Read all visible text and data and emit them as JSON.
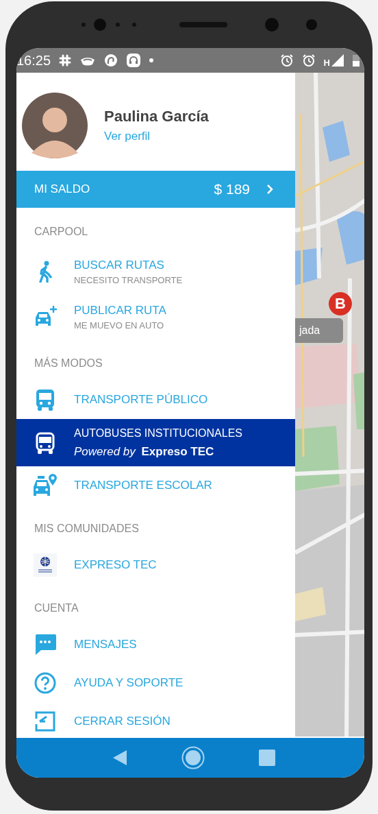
{
  "status_bar": {
    "time": "16:25",
    "network": "H"
  },
  "profile": {
    "name": "Paulina García",
    "link": "Ver perfil"
  },
  "balance": {
    "label": "MI SALDO",
    "amount": "$ 189"
  },
  "sections": [
    {
      "title": "CARPOOL",
      "items": [
        {
          "title": "BUSCAR RUTAS",
          "subtitle": "NECESITO TRANSPORTE",
          "selected": false
        },
        {
          "title": "PUBLICAR RUTA",
          "subtitle": "ME MUEVO EN AUTO",
          "selected": false
        }
      ]
    },
    {
      "title": "MÁS MODOS",
      "items": [
        {
          "title": "TRANSPORTE PÚBLICO",
          "selected": false
        },
        {
          "title": "AUTOBUSES INSTITUCIONALES",
          "subtitle": "*Powered by*  **Expreso TEC**",
          "selected": true
        },
        {
          "title": "TRANSPORTE ESCOLAR",
          "selected": false
        }
      ]
    },
    {
      "title": "MIS COMUNIDADES",
      "items": [
        {
          "title": "EXPRESO TEC",
          "selected": false
        }
      ]
    },
    {
      "title": "CUENTA",
      "items": [
        {
          "title": "MENSAJES",
          "selected": false
        },
        {
          "title": "AYUDA Y SOPORTE",
          "selected": false
        },
        {
          "title": "CERRAR SESIÓN",
          "selected": false
        }
      ]
    }
  ],
  "map": {
    "marker": "B",
    "chip": "jada"
  }
}
